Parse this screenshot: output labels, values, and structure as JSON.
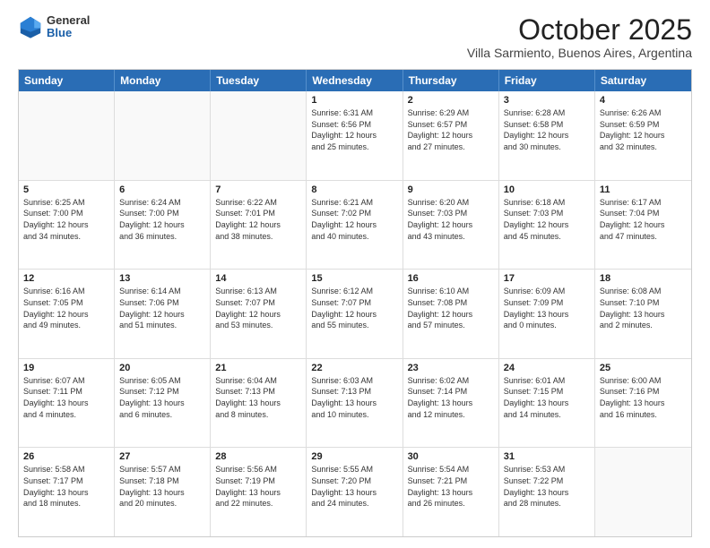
{
  "logo": {
    "general": "General",
    "blue": "Blue"
  },
  "header": {
    "month": "October 2025",
    "location": "Villa Sarmiento, Buenos Aires, Argentina"
  },
  "weekdays": [
    "Sunday",
    "Monday",
    "Tuesday",
    "Wednesday",
    "Thursday",
    "Friday",
    "Saturday"
  ],
  "weeks": [
    [
      {
        "day": "",
        "content": ""
      },
      {
        "day": "",
        "content": ""
      },
      {
        "day": "",
        "content": ""
      },
      {
        "day": "1",
        "content": "Sunrise: 6:31 AM\nSunset: 6:56 PM\nDaylight: 12 hours\nand 25 minutes."
      },
      {
        "day": "2",
        "content": "Sunrise: 6:29 AM\nSunset: 6:57 PM\nDaylight: 12 hours\nand 27 minutes."
      },
      {
        "day": "3",
        "content": "Sunrise: 6:28 AM\nSunset: 6:58 PM\nDaylight: 12 hours\nand 30 minutes."
      },
      {
        "day": "4",
        "content": "Sunrise: 6:26 AM\nSunset: 6:59 PM\nDaylight: 12 hours\nand 32 minutes."
      }
    ],
    [
      {
        "day": "5",
        "content": "Sunrise: 6:25 AM\nSunset: 7:00 PM\nDaylight: 12 hours\nand 34 minutes."
      },
      {
        "day": "6",
        "content": "Sunrise: 6:24 AM\nSunset: 7:00 PM\nDaylight: 12 hours\nand 36 minutes."
      },
      {
        "day": "7",
        "content": "Sunrise: 6:22 AM\nSunset: 7:01 PM\nDaylight: 12 hours\nand 38 minutes."
      },
      {
        "day": "8",
        "content": "Sunrise: 6:21 AM\nSunset: 7:02 PM\nDaylight: 12 hours\nand 40 minutes."
      },
      {
        "day": "9",
        "content": "Sunrise: 6:20 AM\nSunset: 7:03 PM\nDaylight: 12 hours\nand 43 minutes."
      },
      {
        "day": "10",
        "content": "Sunrise: 6:18 AM\nSunset: 7:03 PM\nDaylight: 12 hours\nand 45 minutes."
      },
      {
        "day": "11",
        "content": "Sunrise: 6:17 AM\nSunset: 7:04 PM\nDaylight: 12 hours\nand 47 minutes."
      }
    ],
    [
      {
        "day": "12",
        "content": "Sunrise: 6:16 AM\nSunset: 7:05 PM\nDaylight: 12 hours\nand 49 minutes."
      },
      {
        "day": "13",
        "content": "Sunrise: 6:14 AM\nSunset: 7:06 PM\nDaylight: 12 hours\nand 51 minutes."
      },
      {
        "day": "14",
        "content": "Sunrise: 6:13 AM\nSunset: 7:07 PM\nDaylight: 12 hours\nand 53 minutes."
      },
      {
        "day": "15",
        "content": "Sunrise: 6:12 AM\nSunset: 7:07 PM\nDaylight: 12 hours\nand 55 minutes."
      },
      {
        "day": "16",
        "content": "Sunrise: 6:10 AM\nSunset: 7:08 PM\nDaylight: 12 hours\nand 57 minutes."
      },
      {
        "day": "17",
        "content": "Sunrise: 6:09 AM\nSunset: 7:09 PM\nDaylight: 13 hours\nand 0 minutes."
      },
      {
        "day": "18",
        "content": "Sunrise: 6:08 AM\nSunset: 7:10 PM\nDaylight: 13 hours\nand 2 minutes."
      }
    ],
    [
      {
        "day": "19",
        "content": "Sunrise: 6:07 AM\nSunset: 7:11 PM\nDaylight: 13 hours\nand 4 minutes."
      },
      {
        "day": "20",
        "content": "Sunrise: 6:05 AM\nSunset: 7:12 PM\nDaylight: 13 hours\nand 6 minutes."
      },
      {
        "day": "21",
        "content": "Sunrise: 6:04 AM\nSunset: 7:13 PM\nDaylight: 13 hours\nand 8 minutes."
      },
      {
        "day": "22",
        "content": "Sunrise: 6:03 AM\nSunset: 7:13 PM\nDaylight: 13 hours\nand 10 minutes."
      },
      {
        "day": "23",
        "content": "Sunrise: 6:02 AM\nSunset: 7:14 PM\nDaylight: 13 hours\nand 12 minutes."
      },
      {
        "day": "24",
        "content": "Sunrise: 6:01 AM\nSunset: 7:15 PM\nDaylight: 13 hours\nand 14 minutes."
      },
      {
        "day": "25",
        "content": "Sunrise: 6:00 AM\nSunset: 7:16 PM\nDaylight: 13 hours\nand 16 minutes."
      }
    ],
    [
      {
        "day": "26",
        "content": "Sunrise: 5:58 AM\nSunset: 7:17 PM\nDaylight: 13 hours\nand 18 minutes."
      },
      {
        "day": "27",
        "content": "Sunrise: 5:57 AM\nSunset: 7:18 PM\nDaylight: 13 hours\nand 20 minutes."
      },
      {
        "day": "28",
        "content": "Sunrise: 5:56 AM\nSunset: 7:19 PM\nDaylight: 13 hours\nand 22 minutes."
      },
      {
        "day": "29",
        "content": "Sunrise: 5:55 AM\nSunset: 7:20 PM\nDaylight: 13 hours\nand 24 minutes."
      },
      {
        "day": "30",
        "content": "Sunrise: 5:54 AM\nSunset: 7:21 PM\nDaylight: 13 hours\nand 26 minutes."
      },
      {
        "day": "31",
        "content": "Sunrise: 5:53 AM\nSunset: 7:22 PM\nDaylight: 13 hours\nand 28 minutes."
      },
      {
        "day": "",
        "content": ""
      }
    ]
  ]
}
